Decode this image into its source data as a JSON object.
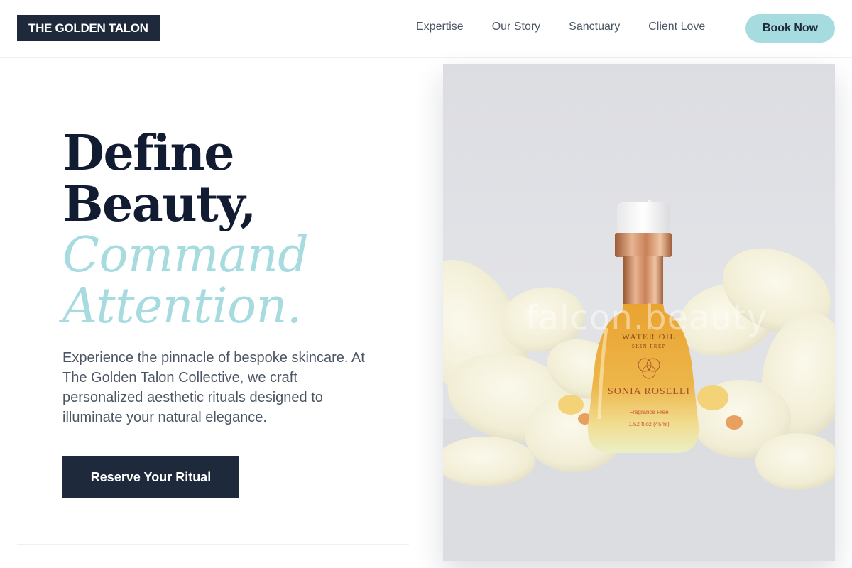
{
  "brand": {
    "name": "THE GOLDEN TALON"
  },
  "nav": {
    "links": [
      "Expertise",
      "Our Story",
      "Sanctuary",
      "Client Love"
    ],
    "book_label": "Book Now"
  },
  "hero": {
    "title_line1": "Define",
    "title_line2": "Beauty,",
    "title_accent1": "Command",
    "title_accent2": "Attention.",
    "description": "Experience the pinnacle of bespoke skincare. At The Golden Talon Collective, we craft personalized aesthetic rituals designed to illuminate your natural elegance.",
    "cta_label": "Reserve Your Ritual"
  },
  "product": {
    "label_line1": "WATER OIL",
    "label_line2": "SKIN PREP",
    "brand": "SONIA ROSELLI",
    "label_line3": "Fragrance Free",
    "label_line4": "1.52 fl.oz (45ml)",
    "watermark": "falcon.beauty"
  },
  "colors": {
    "brand_dark": "#1e293b",
    "accent": "#a6dbe0",
    "oil": "#e6a93a"
  }
}
